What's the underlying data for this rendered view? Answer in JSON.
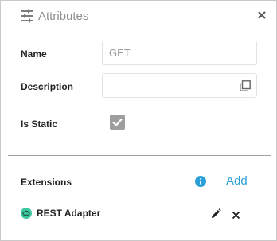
{
  "header": {
    "title": "Attributes",
    "icon": "sliders-icon"
  },
  "form": {
    "name_label": "Name",
    "name_value": "GET",
    "description_label": "Description",
    "description_value": "",
    "is_static_label": "Is Static",
    "is_static_checked": true
  },
  "extensions": {
    "label": "Extensions",
    "add_label": "Add",
    "items": [
      {
        "label": "REST Adapter",
        "icon": "cloud-icon"
      }
    ]
  },
  "colors": {
    "accent": "#2aa0d6",
    "checkbox": "#9e9e9e",
    "cloud_badge": "#3cc8a0",
    "text": "#222222",
    "muted": "#8e8e8e"
  }
}
